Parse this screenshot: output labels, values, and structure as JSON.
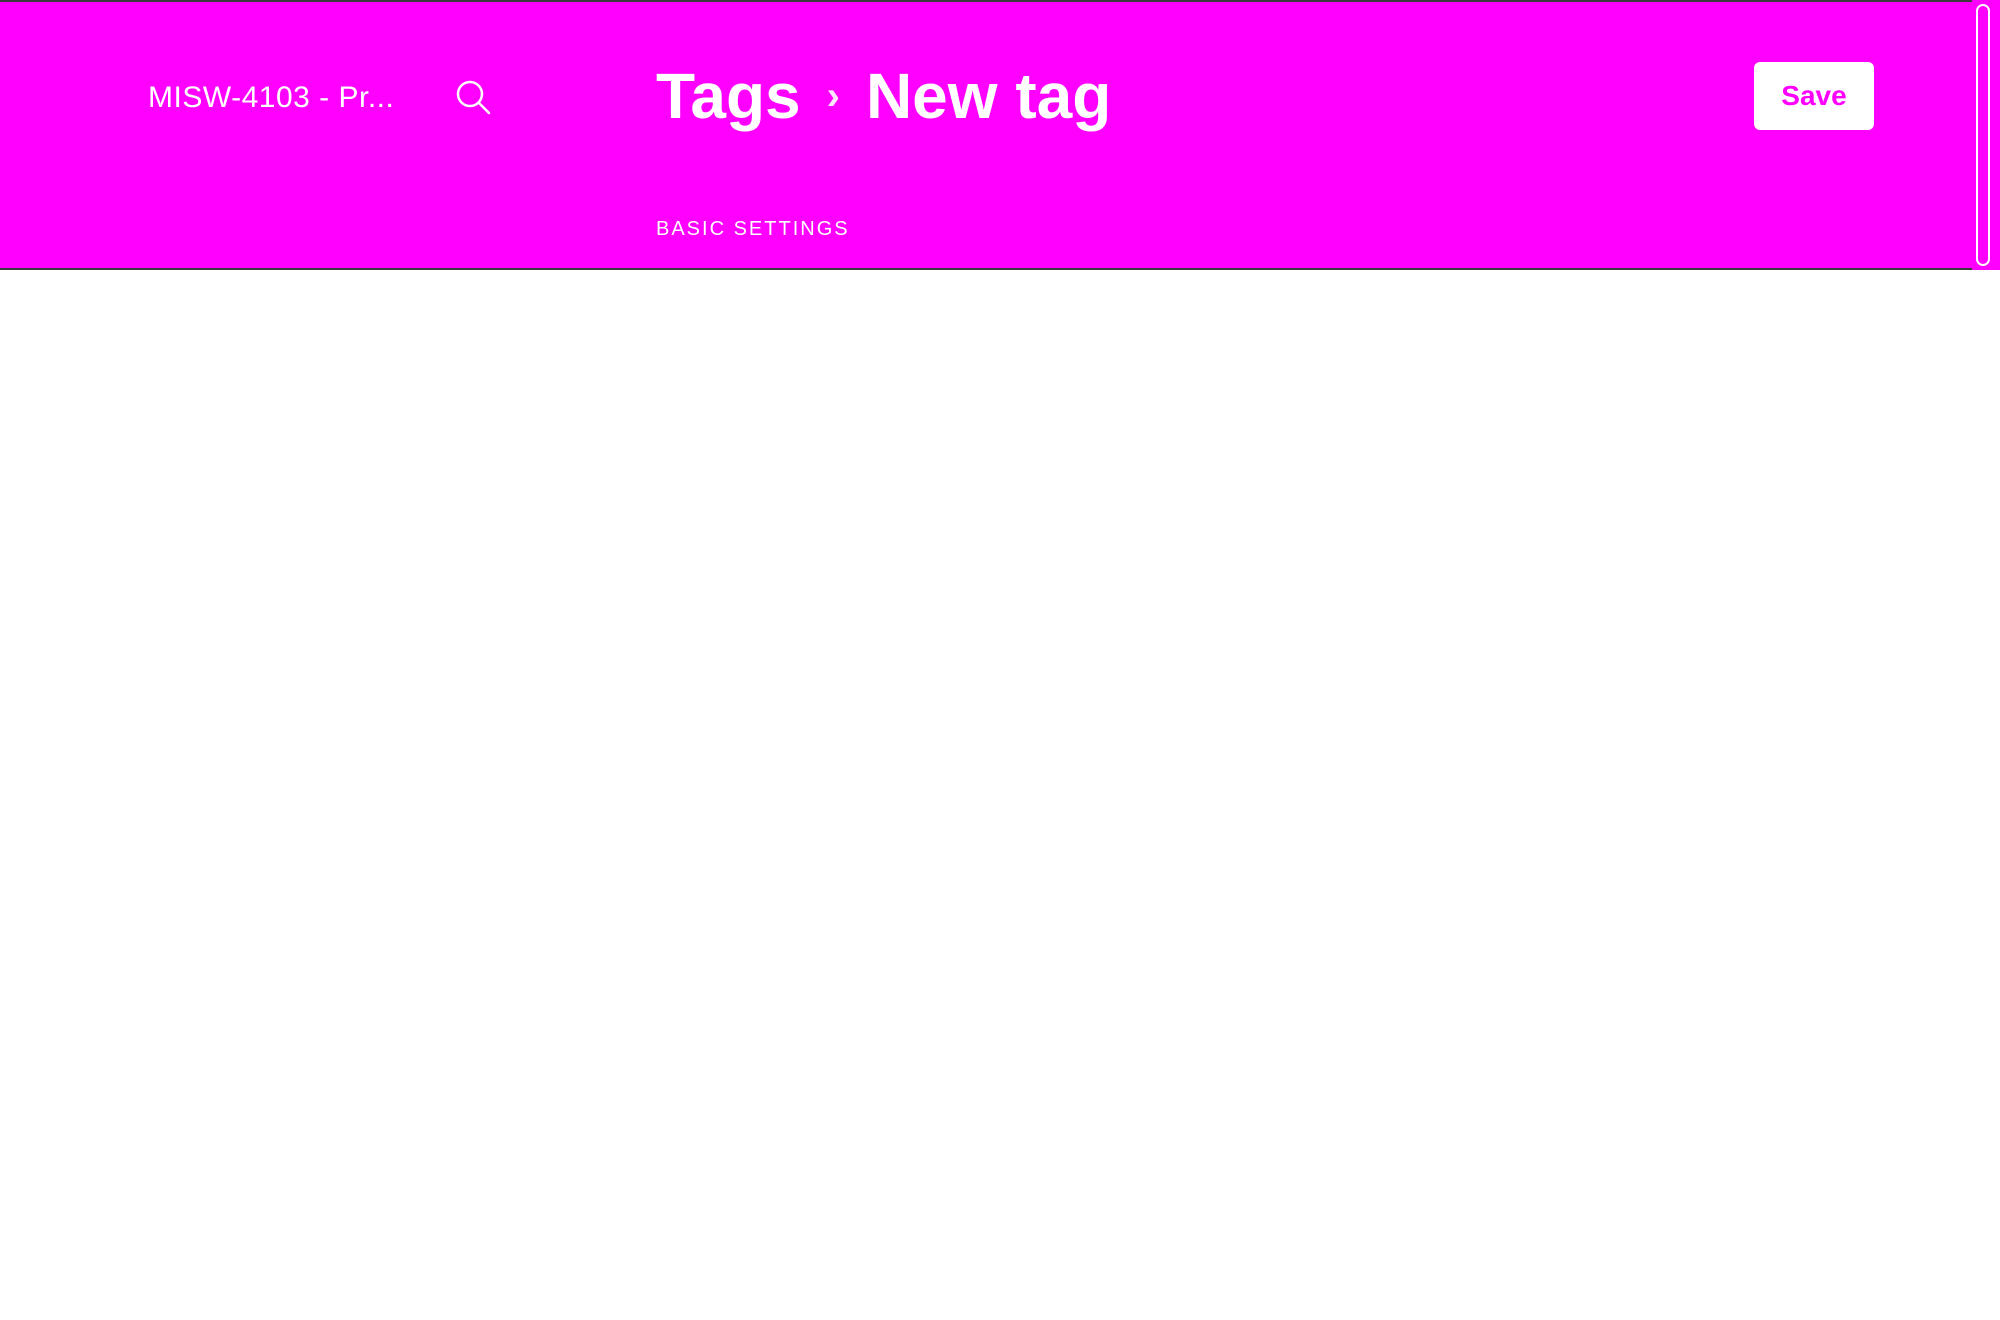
{
  "sidebar": {
    "site_title": "MISW-4103 - Pr...",
    "search_icon": "search-icon"
  },
  "header": {
    "breadcrumb": {
      "parent": "Tags",
      "separator": "›",
      "current": "New tag"
    },
    "save_label": "Save"
  },
  "content": {
    "section_label": "BASIC SETTINGS"
  },
  "colors": {
    "accent": "#ff00ff",
    "text_on_accent": "#ffffff",
    "background": "#ffffff"
  }
}
